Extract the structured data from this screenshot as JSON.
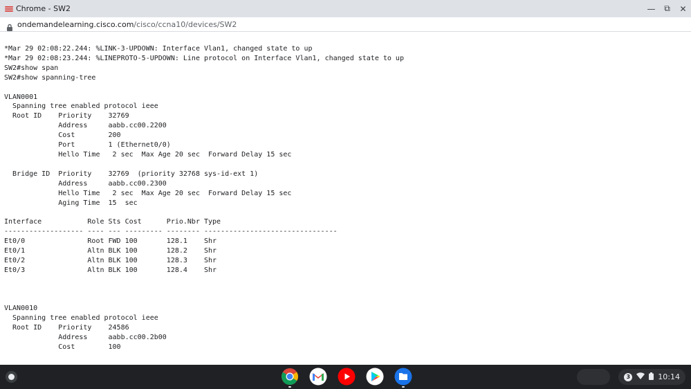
{
  "window": {
    "title": "Chrome - SW2",
    "minimize": "—",
    "restore": "⧉",
    "close": "✕"
  },
  "address": {
    "host": "ondemandelearning.cisco.com",
    "path": "/cisco/ccna10/devices/SW2"
  },
  "terminal": {
    "lines": [
      "*Mar 29 02:08:22.244: %LINK-3-UPDOWN: Interface Vlan1, changed state to up",
      "*Mar 29 02:08:23.244: %LINEPROTO-5-UPDOWN: Line protocol on Interface Vlan1, changed state to up",
      "SW2#show span",
      "SW2#show spanning-tree",
      "",
      "VLAN0001",
      "  Spanning tree enabled protocol ieee",
      "  Root ID    Priority    32769",
      "             Address     aabb.cc00.2200",
      "             Cost        200",
      "             Port        1 (Ethernet0/0)",
      "             Hello Time   2 sec  Max Age 20 sec  Forward Delay 15 sec",
      "",
      "  Bridge ID  Priority    32769  (priority 32768 sys-id-ext 1)",
      "             Address     aabb.cc00.2300",
      "             Hello Time   2 sec  Max Age 20 sec  Forward Delay 15 sec",
      "             Aging Time  15  sec",
      "",
      "Interface           Role Sts Cost      Prio.Nbr Type",
      "------------------- ---- --- --------- -------- --------------------------------",
      "Et0/0               Root FWD 100       128.1    Shr",
      "Et0/1               Altn BLK 100       128.2    Shr",
      "Et0/2               Altn BLK 100       128.3    Shr",
      "Et0/3               Altn BLK 100       128.4    Shr",
      "",
      "",
      "",
      "VLAN0010",
      "  Spanning tree enabled protocol ieee",
      "  Root ID    Priority    24586",
      "             Address     aabb.cc00.2b00",
      "             Cost        100"
    ]
  },
  "shelf": {
    "apps": [
      "chrome-icon",
      "gmail-icon",
      "youtube-icon",
      "play-store-icon",
      "files-icon"
    ],
    "notification_count": "3",
    "time": "10:14"
  }
}
